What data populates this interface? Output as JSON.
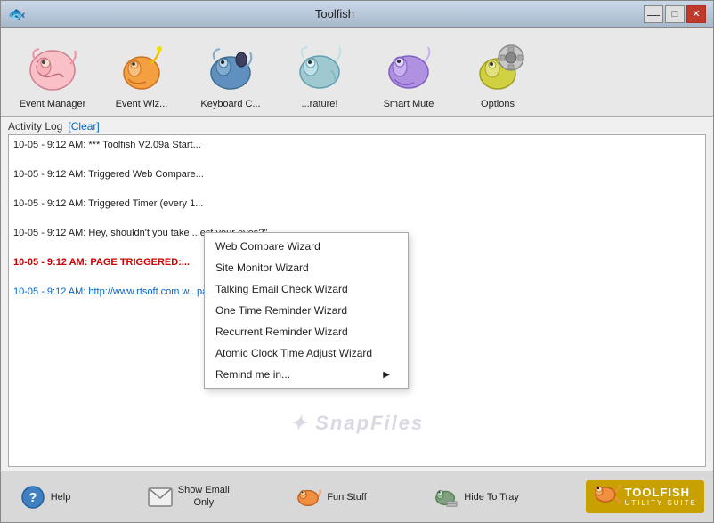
{
  "window": {
    "title": "Toolfish",
    "icon": "🐟"
  },
  "toolbar": {
    "items": [
      {
        "id": "event-manager",
        "label": "Event Manager"
      },
      {
        "id": "event-wizard",
        "label": "Event Wiz..."
      },
      {
        "id": "keyboard",
        "label": "Keyboard C..."
      },
      {
        "id": "screen",
        "label": "...rature!"
      },
      {
        "id": "smart-mute",
        "label": "Smart Mute"
      },
      {
        "id": "options",
        "label": "Options"
      }
    ]
  },
  "activity": {
    "header": "Activity Log",
    "clear_label": "[Clear]",
    "log_entries": [
      {
        "text": "10-05 - 9:12 AM: *** Toolfish V2.09a Start...",
        "type": "normal"
      },
      {
        "text": "10-05 - 9:12 AM: Triggered Web Compare...",
        "type": "normal"
      },
      {
        "text": "10-05 - 9:12 AM: Triggered Timer (every 1...",
        "type": "normal"
      },
      {
        "text": "10-05 - 9:12 AM: Hey, shouldn't you take ...est your eyes?\".",
        "type": "normal"
      },
      {
        "text": "10-05 - 9:12 AM: PAGE TRIGGERED:...",
        "type": "red"
      },
      {
        "text": "10-05 - 9:12 AM: http://www.rtsoft.com w...page for future comparisons.",
        "type": "link"
      }
    ]
  },
  "watermark": {
    "text": "✦ SnapFiles"
  },
  "dropdown_menu": {
    "items": [
      {
        "label": "Web Compare Wizard",
        "has_submenu": false
      },
      {
        "label": "Site Monitor Wizard",
        "has_submenu": false
      },
      {
        "label": "Talking Email Check Wizard",
        "has_submenu": false
      },
      {
        "label": "One Time Reminder Wizard",
        "has_submenu": false
      },
      {
        "label": "Recurrent Reminder Wizard",
        "has_submenu": false
      },
      {
        "label": "Atomic Clock Time Adjust Wizard",
        "has_submenu": false
      },
      {
        "label": "Remind me in...",
        "has_submenu": true
      }
    ]
  },
  "bottom_bar": {
    "items": [
      {
        "id": "help",
        "label": "Help",
        "icon": "❓"
      },
      {
        "id": "show-email",
        "label": "Show Email\nOnly",
        "icon": "✉"
      },
      {
        "id": "fun-stuff",
        "label": "Fun Stuff",
        "icon": "🐟"
      },
      {
        "id": "hide-to-tray",
        "label": "Hide To Tray",
        "icon": "🗕"
      }
    ],
    "logo": {
      "text": "TOOLFISH",
      "sub": "UTILITY SUITE"
    }
  },
  "title_controls": {
    "minimize": "—",
    "maximize": "□",
    "close": "✕"
  }
}
